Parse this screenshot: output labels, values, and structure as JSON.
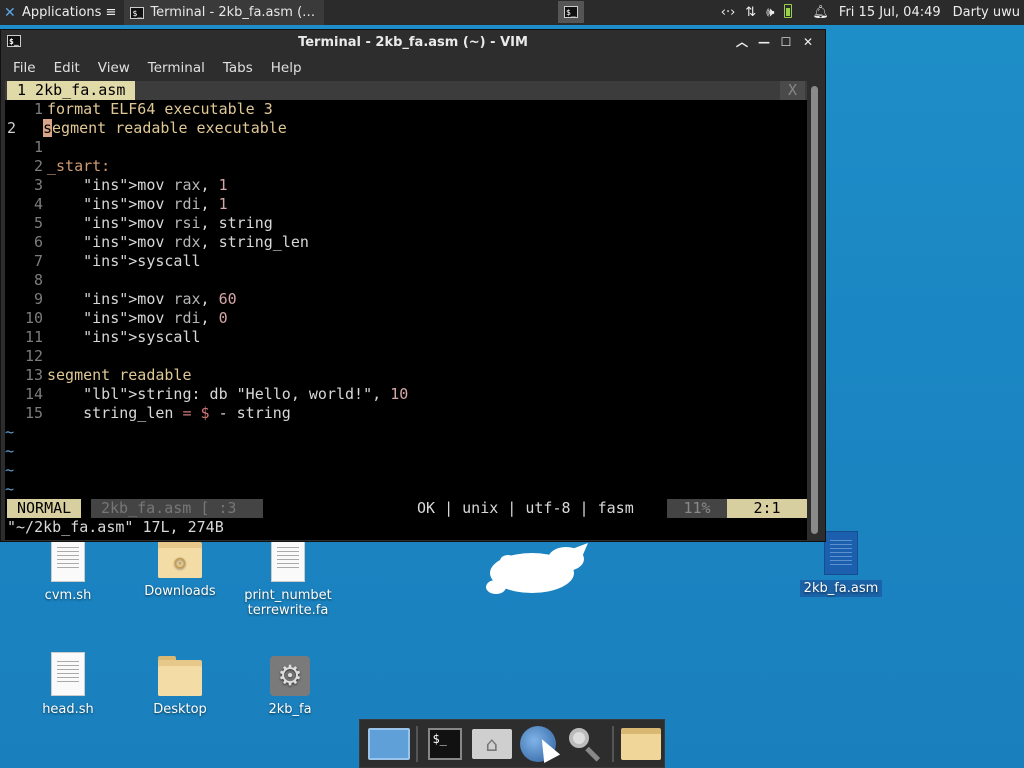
{
  "panel": {
    "applications_label": "Applications ≡",
    "task_label": "Terminal - 2kb_fa.asm (…",
    "clock": "Fri 15 Jul, 04:49",
    "user": "Darty uwu"
  },
  "window": {
    "title": "Terminal - 2kb_fa.asm (~) - VIM",
    "menu": [
      "File",
      "Edit",
      "View",
      "Terminal",
      "Tabs",
      "Help"
    ]
  },
  "vim": {
    "tab_label": "1 2kb_fa.asm",
    "tab_close": "X",
    "lines": [
      {
        "n": "1",
        "code": "format ELF64 executable 3"
      },
      {
        "n": "2",
        "code": "segment readable executable"
      },
      {
        "n": "1",
        "code": ""
      },
      {
        "n": "2",
        "code": "_start:"
      },
      {
        "n": "3",
        "code": "    mov rax, 1"
      },
      {
        "n": "4",
        "code": "    mov rdi, 1"
      },
      {
        "n": "5",
        "code": "    mov rsi, string"
      },
      {
        "n": "6",
        "code": "    mov rdx, string_len"
      },
      {
        "n": "7",
        "code": "    syscall"
      },
      {
        "n": "8",
        "code": ""
      },
      {
        "n": "9",
        "code": "    mov rax, 60"
      },
      {
        "n": "10",
        "code": "    mov rdi, 0"
      },
      {
        "n": "11",
        "code": "    syscall"
      },
      {
        "n": "12",
        "code": ""
      },
      {
        "n": "13",
        "code": "segment readable"
      },
      {
        "n": "14",
        "code": "    string: db \"Hello, world!\", 10"
      },
      {
        "n": "15",
        "code": "    string_len = $ - string"
      }
    ],
    "tilde": "~",
    "status": {
      "mode": "NORMAL",
      "file": "2kb_fa.asm [ :3",
      "info": "OK | unix | utf-8 | fasm",
      "percent": "11%",
      "position": "2:1"
    },
    "cmdline": "\"~/2kb_fa.asm\" 17L, 274B"
  },
  "desktop": {
    "icons": [
      {
        "label": "cvm.sh"
      },
      {
        "label": "Downloads"
      },
      {
        "label": "print_numbet terrewrite.fa"
      },
      {
        "label": "head.sh"
      },
      {
        "label": "Desktop"
      },
      {
        "label": "2kb_fa"
      },
      {
        "label": "2kb_fa.asm"
      }
    ]
  },
  "dock": {
    "items": [
      "show-desktop-icon",
      "terminal-icon",
      "home-folder-icon",
      "web-browser-icon",
      "app-finder-icon",
      "files-icon"
    ]
  },
  "colors": {
    "desktop_bg": "#1a86c3",
    "terminal_bg": "#000000",
    "status_mode_bg": "#d7cfa0"
  }
}
